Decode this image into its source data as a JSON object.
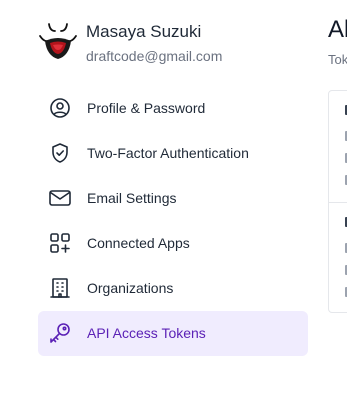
{
  "user": {
    "name": "Masaya Suzuki",
    "email": "draftcode@gmail.com"
  },
  "nav": {
    "items": [
      {
        "label": "Profile & Password",
        "icon": "user-circle-icon"
      },
      {
        "label": "Two-Factor Authentication",
        "icon": "shield-check-icon"
      },
      {
        "label": "Email Settings",
        "icon": "envelope-icon"
      },
      {
        "label": "Connected Apps",
        "icon": "squares-plus-icon"
      },
      {
        "label": "Organizations",
        "icon": "building-icon"
      },
      {
        "label": "API Access Tokens",
        "icon": "key-icon",
        "active": true
      }
    ]
  },
  "content": {
    "title": "Al",
    "subtitle": "Tok"
  },
  "colors": {
    "active_bg": "#f0ecfe",
    "active_text": "#5b21b6",
    "text": "#1f2937",
    "muted": "#6b7280",
    "border": "#e5e7eb"
  }
}
